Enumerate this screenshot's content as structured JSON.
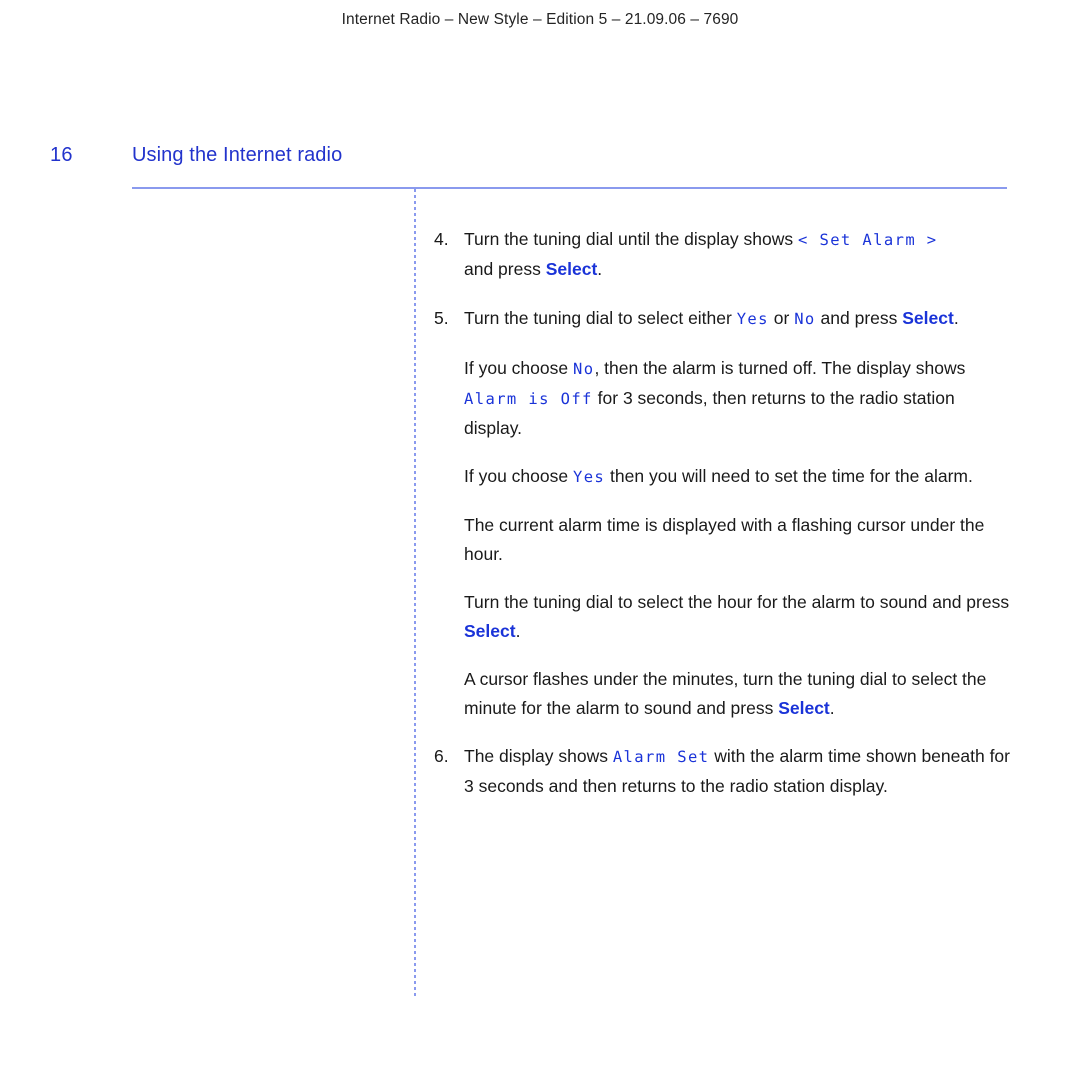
{
  "colors": {
    "accent_blue": "#2233cc",
    "button_blue": "#1a33d8",
    "rule_blue": "#8a9aee",
    "body_text": "#1a1a1a"
  },
  "running_header": "Internet Radio – New Style – Edition 5 – 21.09.06 – 7690",
  "page_number": "16",
  "chapter_title": "Using the Internet radio",
  "steps": [
    {
      "number": "4.",
      "line1_a": "Turn the tuning dial until the display shows ",
      "line1_lcd": "< Set Alarm >",
      "line2_a": "and press ",
      "line2_button": "Select",
      "line2_b": "."
    },
    {
      "number": "5.",
      "line1_a": "Turn the tuning dial to select either ",
      "line1_lcd1": "Yes",
      "line1_b": " or ",
      "line1_lcd2": "No",
      "line1_c": " and press ",
      "line1_button": "Select",
      "line1_d": "."
    },
    {
      "number": "6.",
      "text_a": "The display shows ",
      "lcd": "Alarm Set",
      "text_b": " with the alarm time shown beneath for 3 seconds and then returns to the radio station display."
    }
  ],
  "paragraphs": {
    "p1": {
      "a": "If you choose ",
      "lcd1": "No",
      "b": ", then the alarm is turned off. The display shows ",
      "lcd2": "Alarm is Off",
      "c": " for 3 seconds, then returns to the radio station display."
    },
    "p2": {
      "a": "If you choose ",
      "lcd1": "Yes",
      "b": " then you will need to set the time for the alarm."
    },
    "p3": {
      "text": "The current alarm time is displayed with a flashing cursor under the hour."
    },
    "p4": {
      "a": "Turn the tuning dial to select the hour for the alarm to sound and press ",
      "button": "Select",
      "b": "."
    },
    "p5": {
      "a": "A cursor flashes under the minutes, turn the tuning dial to select the minute for the alarm to sound and press ",
      "button": "Select",
      "b": "."
    }
  }
}
